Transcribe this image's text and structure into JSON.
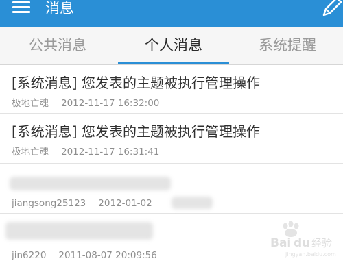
{
  "app_bar": {
    "title": "消息",
    "menu_icon": "hamburger-menu-icon",
    "edit_icon": "pencil-edit-icon",
    "color": "#2a8fd6"
  },
  "tabs": [
    {
      "label": "公共消息",
      "active": false
    },
    {
      "label": "个人消息",
      "active": true
    },
    {
      "label": "系统提醒",
      "active": false
    }
  ],
  "messages": [
    {
      "title": "[系统消息] 您发表的主题被执行管理操作",
      "sender": "极地亡魂",
      "time": "2012-11-17 16:32:00",
      "obscured": false
    },
    {
      "title": "[系统消息] 您发表的主题被执行管理操作",
      "sender": "极地亡魂",
      "time": "2012-11-17 16:31:41",
      "obscured": false
    },
    {
      "title": "",
      "sender": "jiangsong25123",
      "time": "2012-01-02",
      "obscured": true
    },
    {
      "title": "",
      "sender": "jin6220",
      "time": "2011-08-07 20:09:56",
      "obscured": true
    }
  ],
  "watermark": {
    "text": "Baidu经验",
    "sub": "jingyan.baidu.com"
  }
}
